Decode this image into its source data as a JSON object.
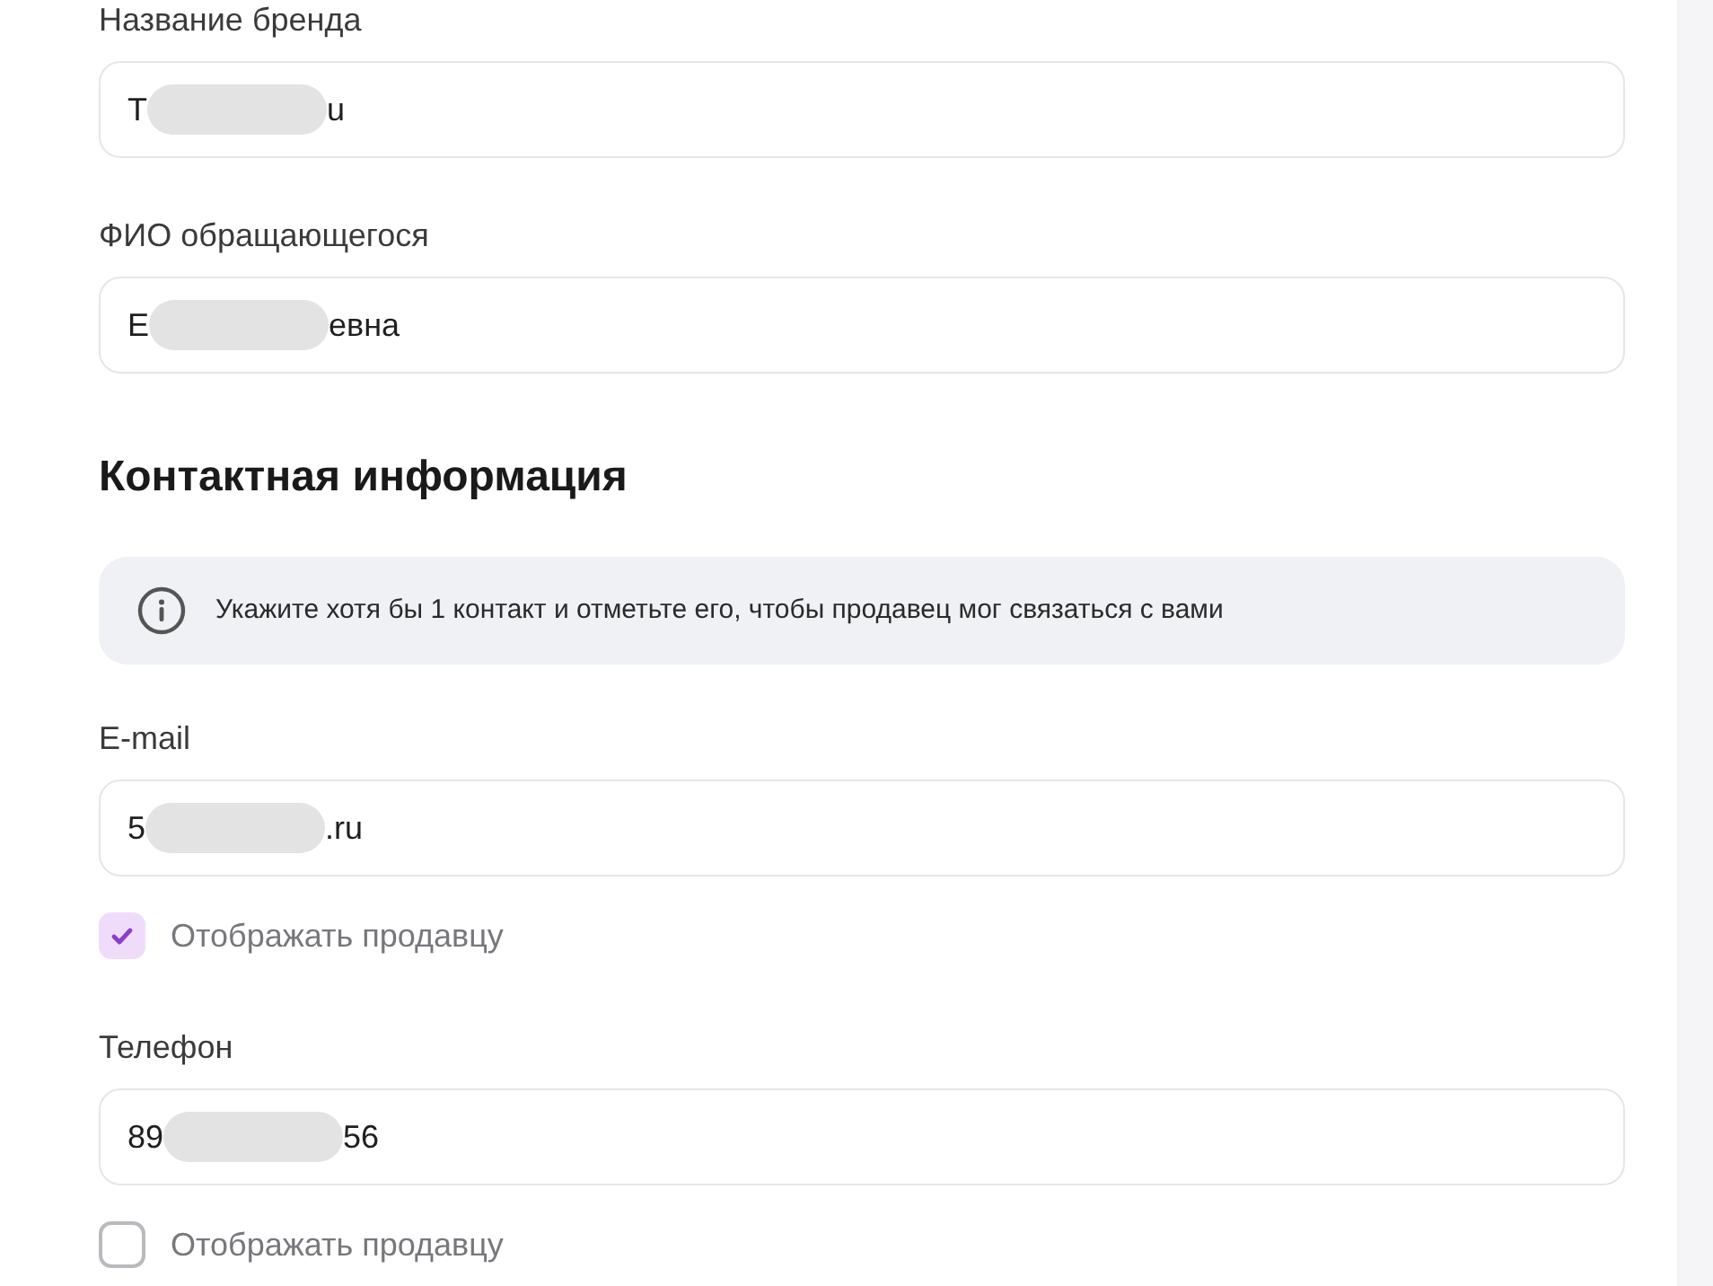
{
  "fields_top": [
    {
      "label": "Название бренда",
      "value_parts": [
        "Т",
        "u"
      ]
    },
    {
      "label": "ФИО обращающегося",
      "value_parts": [
        "Е",
        "евна"
      ]
    }
  ],
  "section": {
    "title": "Контактная информация",
    "notice": "Укажите хотя бы 1 контакт и отметьте его, чтобы продавец мог связаться с вами"
  },
  "contacts": [
    {
      "label": "E-mail",
      "value_parts": [
        "5",
        ".ru"
      ],
      "show_to_seller": {
        "label": "Отображать продавцу",
        "checked": true
      }
    },
    {
      "label": "Телефон",
      "value_parts": [
        "89",
        "56"
      ],
      "show_to_seller": {
        "label": "Отображать продавцу",
        "checked": false
      }
    }
  ]
}
